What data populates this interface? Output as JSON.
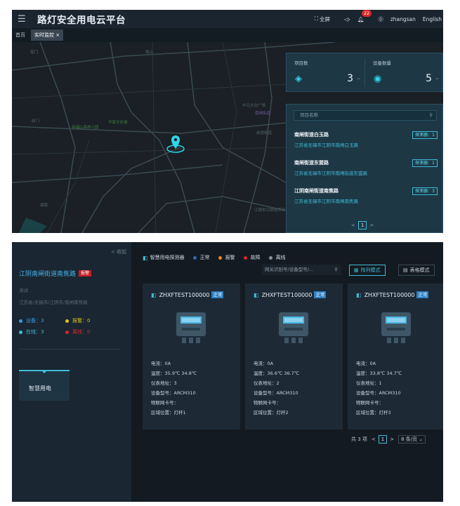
{
  "header": {
    "title": "路灯安全用电云平台",
    "fullscreen": "全屏",
    "sound_icon": "speaker-icon",
    "notifications": "22",
    "username": "zhangsan",
    "language": "English"
  },
  "tabs": [
    {
      "label": "首页"
    },
    {
      "label": "实时监控",
      "close": "×"
    }
  ],
  "map_labels": [
    "南门",
    "昆山",
    "前门",
    "湖南",
    "帝福山森林公园",
    "华家文化城",
    "中元文化广场",
    "南闸街道",
    "前进街道",
    "江阴市江阴经济开发区"
  ],
  "stats": {
    "project_label": "项目数",
    "project_value": "3",
    "device_label": "设备数量",
    "device_value": "5",
    "arrow": "^"
  },
  "projects": {
    "search_placeholder": "项目名称",
    "items": [
      {
        "name": "南闸街道白玉路",
        "address": "江苏省无锡市江阴市南闸白玉路",
        "detectors": "探测器：1"
      },
      {
        "name": "南闸街道东盟路",
        "address": "江苏省无锡市江阴市南闸街道东盟路",
        "detectors": "探测器：1"
      },
      {
        "name": "江阴南闸街道南焦路",
        "address": "江苏省无锡市江阴市南闸南焦路",
        "detectors": "探测器：3"
      }
    ],
    "page": "1",
    "prev": "<",
    "next": ">"
  },
  "detail": {
    "collapse": "< 收起",
    "project_name": "江阴南闸街道南焦路",
    "alarm_tag": "报警",
    "type": "测试",
    "address": "江苏省/无锡市/江阴市/南闸南焦路",
    "devices": "设备：3",
    "alarms": "报警：0",
    "online": "在线：3",
    "offline": "离线：0",
    "module": "智慧用电"
  },
  "legend": {
    "title": "智慧用电探测器",
    "normal": "正常",
    "alarm": "报警",
    "fault": "故障",
    "offline": "离线"
  },
  "toolbar": {
    "search_placeholder": "网关识别号/设备型号/...",
    "array_mode": "阵列模式",
    "table_mode": "表格模式"
  },
  "cards": [
    {
      "id": "ZHXFTEST100000",
      "status": "正常",
      "current": "电流：0A",
      "temp": "温度：35.9℃ 34.8℃",
      "meter_addr": "仪表地址：3",
      "model": "设备型号：ARCM310",
      "iot_card": "物联网卡号：",
      "location": "区域位置：灯杆1"
    },
    {
      "id": "ZHXFTEST100000",
      "status": "正常",
      "current": "电流：0A",
      "temp": "温度：36.6℃ 36.7℃",
      "meter_addr": "仪表地址：2",
      "model": "设备型号：ARCM310",
      "iot_card": "物联网卡号：",
      "location": "区域位置：灯杆2"
    },
    {
      "id": "ZHXFTEST100000",
      "status": "正常",
      "current": "电流：0A",
      "temp": "温度：33.8℃ 34.7℃",
      "meter_addr": "仪表地址：1",
      "model": "设备型号：ARCM310",
      "iot_card": "物联网卡号：",
      "location": "区域位置：灯杆3"
    }
  ],
  "footer": {
    "total": "共 3 项",
    "prev": "<",
    "page": "1",
    "next": ">",
    "page_size": "8 条/页"
  },
  "colors": {
    "accent": "#3fbcd6",
    "normal": "#2b7fc1",
    "alarm": "#e0b020",
    "fault": "#d9262b",
    "offline": "#8a949c"
  }
}
